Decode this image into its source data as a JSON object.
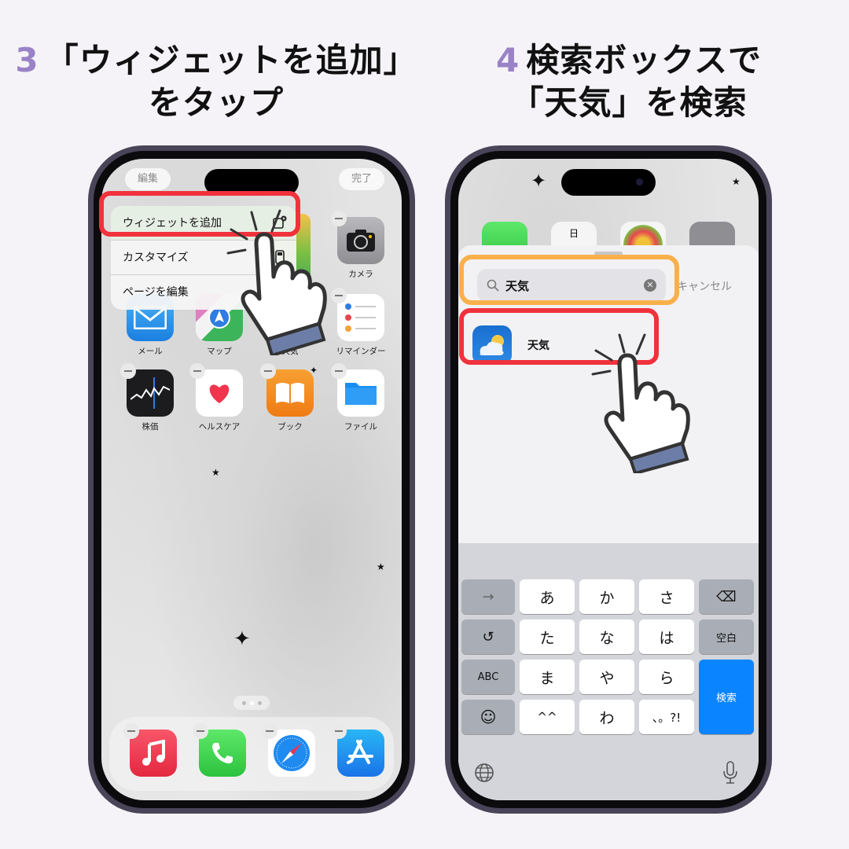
{
  "steps": [
    {
      "number": "3",
      "line1": "「ウィジェットを追加」",
      "line2": "をタップ"
    },
    {
      "number": "4",
      "line1": "検索ボックスで",
      "line2": "「天気」を検索"
    }
  ],
  "phone1": {
    "edit_pill": "編集",
    "done_pill": "完了",
    "context_menu": [
      {
        "label": "ウィジェットを追加",
        "icon": "widget-add-icon"
      },
      {
        "label": "カスタマイズ",
        "icon": "customize-icon"
      },
      {
        "label": "ページを編集",
        "icon": ""
      }
    ],
    "apps": [
      {
        "label": "カメラ",
        "icon": "camera-icon"
      },
      {
        "label": "メール",
        "icon": "mail-icon"
      },
      {
        "label": "マップ",
        "icon": "maps-icon"
      },
      {
        "label": "天気",
        "icon": "weather-icon"
      },
      {
        "label": "リマインダー",
        "icon": "reminders-icon"
      },
      {
        "label": "株価",
        "icon": "stocks-icon"
      },
      {
        "label": "ヘルスケア",
        "icon": "health-icon"
      },
      {
        "label": "ブック",
        "icon": "books-icon"
      },
      {
        "label": "ファイル",
        "icon": "files-icon"
      }
    ],
    "dock": [
      "music-icon",
      "phone-icon",
      "safari-icon",
      "app-store-icon"
    ],
    "page_dots": 3,
    "active_page": 2
  },
  "phone2": {
    "calendar_day": "日",
    "search_query": "天気",
    "cancel_label": "キャンセル",
    "result_label": "天気",
    "keyboard": {
      "rows": [
        [
          "→",
          "あ",
          "か",
          "さ",
          "⌫"
        ],
        [
          "↺",
          "た",
          "な",
          "は",
          "空白"
        ],
        [
          "ABC",
          "ま",
          "や",
          "ら",
          "検索"
        ],
        [
          "☺",
          "^^",
          "わ",
          "、。?!"
        ]
      ]
    }
  },
  "colors": {
    "accent_number": "#9a82c6",
    "highlight_red": "#f0323c",
    "highlight_orange": "#f9b04a",
    "search_key": "#0a84ff"
  }
}
